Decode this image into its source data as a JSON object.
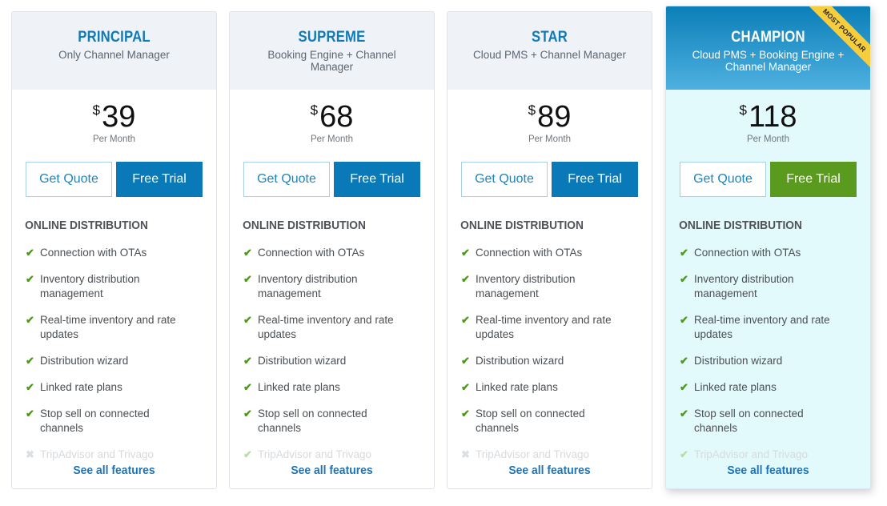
{
  "colors": {
    "brand_blue": "#0a79b7",
    "plan_name_blue": "#0e7ab8",
    "trial_green": "#5a9a1f",
    "check_green": "#4c9a18",
    "ribbon_yellow": "#f6cd3c",
    "featured_bg": "#e3fafd"
  },
  "icons": {
    "check": "✔",
    "cross": "✖"
  },
  "plans": [
    {
      "name": "PRINCIPAL",
      "subtitle": "Only Channel Manager",
      "currency": "$",
      "price": "39",
      "period": "Per Month",
      "quote_label": "Get Quote",
      "trial_label": "Free Trial",
      "section_title": "ONLINE DISTRIBUTION",
      "features": [
        {
          "label": "Connection with OTAs",
          "included": true
        },
        {
          "label": "Inventory distribution management",
          "included": true
        },
        {
          "label": "Real-time inventory and rate updates",
          "included": true
        },
        {
          "label": "Distribution wizard",
          "included": true
        },
        {
          "label": "Linked rate plans",
          "included": true
        },
        {
          "label": "Stop sell on connected channels",
          "included": true
        },
        {
          "label": "TripAdvisor and Trivago",
          "included": false
        }
      ],
      "see_all_label": "See all features"
    },
    {
      "name": "SUPREME",
      "subtitle": "Booking Engine + Channel Manager",
      "currency": "$",
      "price": "68",
      "period": "Per Month",
      "quote_label": "Get Quote",
      "trial_label": "Free Trial",
      "section_title": "ONLINE DISTRIBUTION",
      "features": [
        {
          "label": "Connection with OTAs",
          "included": true
        },
        {
          "label": "Inventory distribution management",
          "included": true
        },
        {
          "label": "Real-time inventory and rate updates",
          "included": true
        },
        {
          "label": "Distribution wizard",
          "included": true
        },
        {
          "label": "Linked rate plans",
          "included": true
        },
        {
          "label": "Stop sell on connected channels",
          "included": true
        },
        {
          "label": "TripAdvisor and Trivago",
          "included": true
        }
      ],
      "see_all_label": "See all features"
    },
    {
      "name": "STAR",
      "subtitle": "Cloud PMS + Channel Manager",
      "currency": "$",
      "price": "89",
      "period": "Per Month",
      "quote_label": "Get Quote",
      "trial_label": "Free Trial",
      "section_title": "ONLINE DISTRIBUTION",
      "features": [
        {
          "label": "Connection with OTAs",
          "included": true
        },
        {
          "label": "Inventory distribution management",
          "included": true
        },
        {
          "label": "Real-time inventory and rate updates",
          "included": true
        },
        {
          "label": "Distribution wizard",
          "included": true
        },
        {
          "label": "Linked rate plans",
          "included": true
        },
        {
          "label": "Stop sell on connected channels",
          "included": true
        },
        {
          "label": "TripAdvisor and Trivago",
          "included": false
        }
      ],
      "see_all_label": "See all features"
    },
    {
      "name": "CHAMPION",
      "subtitle": "Cloud PMS + Booking Engine + Channel Manager",
      "badge": "MOST POPULAR",
      "currency": "$",
      "price": "118",
      "period": "Per Month",
      "quote_label": "Get Quote",
      "trial_label": "Free Trial",
      "section_title": "ONLINE DISTRIBUTION",
      "features": [
        {
          "label": "Connection with OTAs",
          "included": true
        },
        {
          "label": "Inventory distribution management",
          "included": true
        },
        {
          "label": "Real-time inventory and rate updates",
          "included": true
        },
        {
          "label": "Distribution wizard",
          "included": true
        },
        {
          "label": "Linked rate plans",
          "included": true
        },
        {
          "label": "Stop sell on connected channels",
          "included": true
        },
        {
          "label": "TripAdvisor and Trivago",
          "included": true
        }
      ],
      "see_all_label": "See all features"
    }
  ]
}
